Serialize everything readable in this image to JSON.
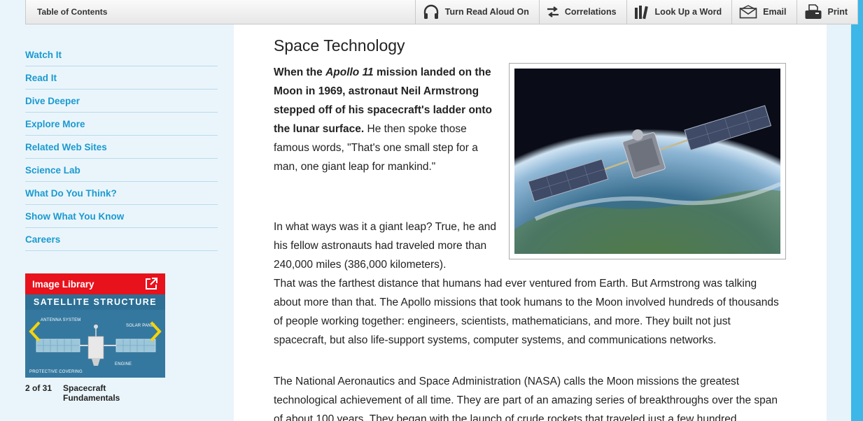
{
  "toolbar": {
    "toc_label": "Table of Contents",
    "read_aloud_label": "Turn Read Aloud On",
    "correlations_label": "Correlations",
    "lookup_label": "Look Up a Word",
    "email_label": "Email",
    "print_label": "Print"
  },
  "sidebar": {
    "items": [
      {
        "label": "Watch It"
      },
      {
        "label": "Read It"
      },
      {
        "label": "Dive Deeper"
      },
      {
        "label": "Explore More"
      },
      {
        "label": "Related Web Sites"
      },
      {
        "label": "Science Lab"
      },
      {
        "label": "What Do You Think?"
      },
      {
        "label": "Show What You Know"
      },
      {
        "label": "Careers"
      }
    ],
    "image_library": {
      "title": "Image Library",
      "thumb_title": "SATELLITE STRUCTURE",
      "thumb_labels": {
        "antenna": "ANTENNA SYSTEM",
        "solar": "SOLAR PANEL",
        "engine": "ENGINE",
        "covering": "PROTECTIVE COVERING"
      },
      "counter": "2 of 31",
      "caption": "Spacecraft Fundamentals"
    }
  },
  "article": {
    "title": "Space Technology",
    "p1_bold_a": "When the ",
    "p1_italic": "Apollo 11",
    "p1_bold_b": " mission landed on the Moon in 1969, astronaut Neil Armstrong stepped off of his spacecraft's ladder onto the lunar surface.",
    "p1_rest": " He then spoke those famous words, \"That's one small step for a man, one giant leap for mankind.\"",
    "p2_narrow": "In what ways was it a giant leap? True, he and his fellow astronauts had traveled more than 240,000 miles (386,000 kilometers).",
    "p2_rest": "That was the farthest distance that humans had ever ventured from Earth. But Armstrong was talking about more than that. The Apollo missions that took humans to the Moon involved hundreds of thousands of people working together: engineers, scientists, mathematicians, and more. They built not just spacecraft, but also life-support systems, computer systems, and communications networks.",
    "p3": "The National Aeronautics and Space Administration (NASA) calls the Moon missions the greatest technological achievement of all time. They are part of an amazing series of breakthroughs over the span of about 100 years. They began with the launch of crude rockets that traveled just a few hundred"
  },
  "colors": {
    "link": "#1a9ad0",
    "library_red": "#e8121c",
    "edge_blue": "#3db6e8"
  }
}
